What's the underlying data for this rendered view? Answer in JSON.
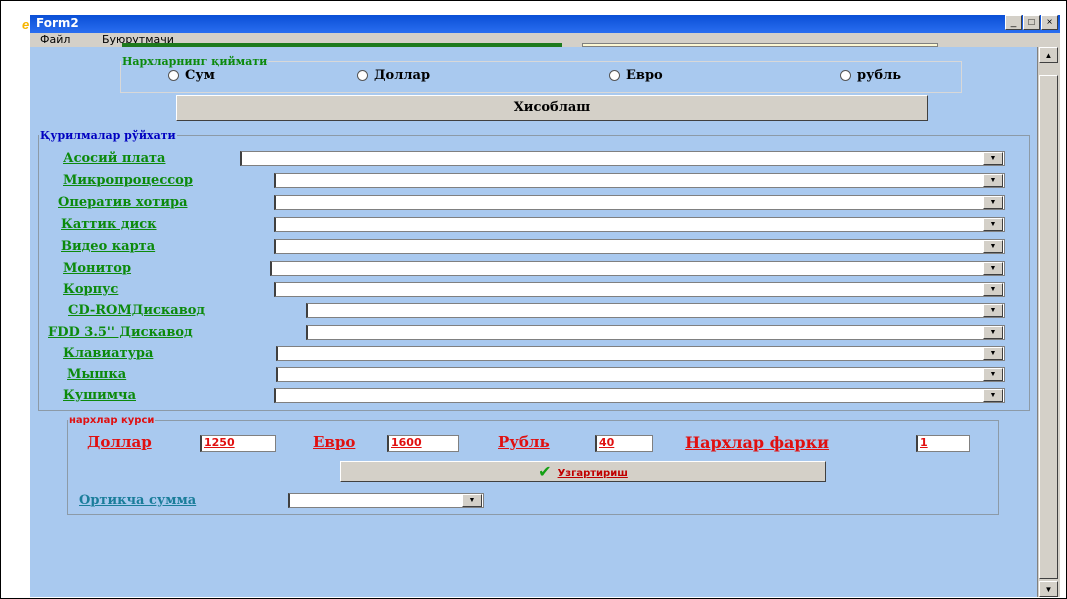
{
  "window": {
    "title": "Form2",
    "title_icon": "delphi-icon",
    "buttons": [
      "_",
      "□",
      "×"
    ]
  },
  "menu": {
    "items": [
      "Файл",
      "Буюрутмачи"
    ]
  },
  "price_type": {
    "legend": "Нархларнинг қиймати",
    "options": [
      "Сум",
      "Доллар",
      "Евро",
      "рубль"
    ]
  },
  "calculate_button": "Хисоблаш",
  "devices": {
    "legend": "Қурилмалар рўйхати",
    "items": [
      {
        "label": "Асосий плата",
        "value": ""
      },
      {
        "label": "Микропроцессор",
        "value": ""
      },
      {
        "label": "Оператив хотира",
        "value": ""
      },
      {
        "label": "Каттик диск",
        "value": ""
      },
      {
        "label": "Видео карта",
        "value": ""
      },
      {
        "label": "Монитор",
        "value": ""
      },
      {
        "label": "Корпус",
        "value": ""
      },
      {
        "label": "CD-ROMДискавод",
        "value": ""
      },
      {
        "label": "FDD 3.5'' Дискавод",
        "value": ""
      },
      {
        "label": "Клавиатура",
        "value": ""
      },
      {
        "label": "Мышка",
        "value": ""
      },
      {
        "label": "Кушимча",
        "value": ""
      }
    ]
  },
  "rates": {
    "legend": "нархлар курси",
    "dollar_label": "Доллар",
    "dollar_value": "1250",
    "euro_label": "Евро",
    "euro_value": "1600",
    "ruble_label": "Рубль",
    "ruble_value": "40",
    "diff_label": "Нархлар фарки",
    "diff_value": "1",
    "change_button": "Узгартириш",
    "extra_label": "Ортикча сумма",
    "extra_value": ""
  },
  "colors": {
    "window_bg": "#a9c9ef",
    "title_bar": "#0a4fd6",
    "device_label": "#0c8a0c",
    "rate_label": "#e01010"
  }
}
